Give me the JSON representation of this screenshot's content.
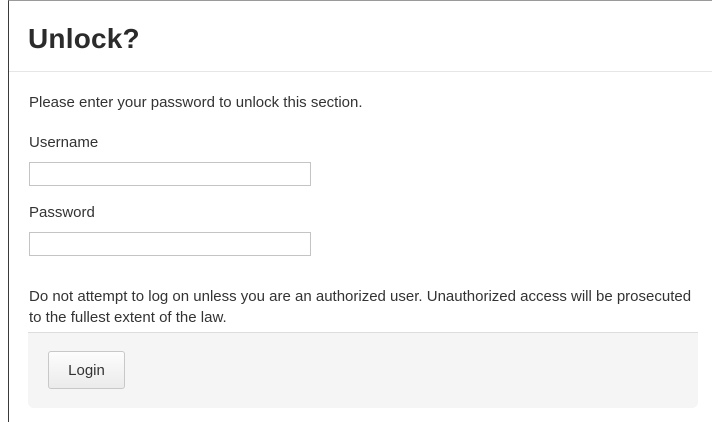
{
  "dialog": {
    "title": "Unlock?",
    "intro": "Please enter your password to unlock this section.",
    "username_label": "Username",
    "username_value": "",
    "password_label": "Password",
    "password_value": "",
    "warning": "Do not attempt to log on unless you are an authorized user. Unauthorized access will be prosecuted to the fullest extent of the law.",
    "login_label": "Login"
  }
}
